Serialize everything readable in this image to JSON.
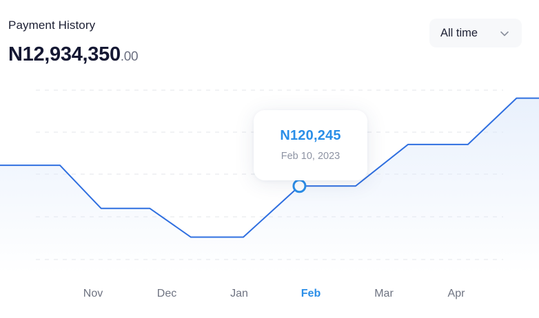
{
  "header": {
    "title": "Payment History",
    "total_main": "N12,934,350",
    "total_decimal": ".00"
  },
  "period_select": {
    "selected": "All time",
    "icon": "chevron-down-icon"
  },
  "tooltip": {
    "value": "N120,245",
    "date": "Feb 10, 2023"
  },
  "colors": {
    "line": "#2f6fe0",
    "accent": "#2a8ee8",
    "fill_top": "#dde9fb",
    "grid": "#e3e5ea"
  },
  "chart_data": {
    "type": "area",
    "x_labels": [
      "Nov",
      "Dec",
      "Jan",
      "Feb",
      "Mar",
      "Apr"
    ],
    "active_label": "Feb",
    "series": [
      {
        "points": [
          {
            "x": 0.0,
            "y": 55
          },
          {
            "x": 0.8,
            "y": 55
          },
          {
            "x": 1.35,
            "y": 28
          },
          {
            "x": 2.0,
            "y": 28
          },
          {
            "x": 2.55,
            "y": 10
          },
          {
            "x": 3.25,
            "y": 10
          },
          {
            "x": 4.0,
            "y": 42
          },
          {
            "x": 4.75,
            "y": 42
          },
          {
            "x": 5.45,
            "y": 68
          },
          {
            "x": 6.25,
            "y": 68
          },
          {
            "x": 6.9,
            "y": 97
          },
          {
            "x": 7.2,
            "y": 97
          }
        ],
        "highlight_x": 4.0
      }
    ],
    "x_range": [
      0,
      7.2
    ],
    "y_range": [
      -4,
      102
    ],
    "grid": true,
    "legend": "none"
  }
}
